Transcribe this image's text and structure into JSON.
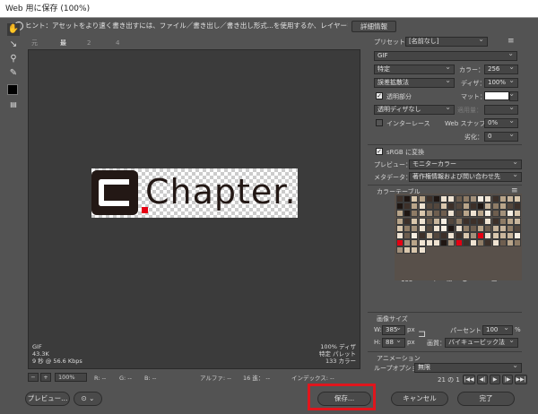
{
  "window": {
    "title": "Web 用に保存 (100%)"
  },
  "hint": {
    "text": "ヒント：アセットをより速く書き出すには、ファイル／書き出し／書き出し形式...を使用するか、レイヤーを右クリックして使用。",
    "detail_button": "詳細情報"
  },
  "tabs": [
    "元画像",
    "最適化",
    "2 アップ",
    "4 アップ"
  ],
  "active_tab": "最適化",
  "preview": {
    "logo_text": "Chapter."
  },
  "canvas_info_left": [
    "GIF",
    "43.3K",
    "9 秒 @ 56.6 Kbps"
  ],
  "canvas_info_right": [
    "100% ディザ",
    "特定 パレット",
    "133 カラー"
  ],
  "statusbar": {
    "zoom": "100%",
    "r": "R: --",
    "g": "G: --",
    "b": "B: --",
    "alpha": "アルファ: --",
    "hex": "16 進： --",
    "index": "インデックス: --"
  },
  "right": {
    "preset_label": "プリセット：",
    "preset_value": "[名前なし]",
    "format": "GIF",
    "palette": "特定",
    "colors_label": "カラー：",
    "colors_value": "256",
    "dither_algo": "誤差拡散法",
    "dither_label": "ディザ：",
    "dither_value": "100%",
    "transparency_label": "透明部分",
    "matte_label": "マット：",
    "transparency_dither": "透明ディザなし",
    "amount_label": "適用量：",
    "interlace_label": "インターレース",
    "web_snap_label": "Web スナップ：",
    "web_snap_value": "0%",
    "lossy_label": "劣化：",
    "lossy_value": "0",
    "srgb_label": "sRGB に変換",
    "preview_label": "プレビュー：",
    "preview_value": "モニターカラー",
    "metadata_label": "メタデータ：",
    "metadata_value": "著作権情報および問い合わせ先",
    "color_table_label": "カラーテーブル",
    "color_count": "133",
    "image_size_label": "画像サイズ",
    "w_label": "W:",
    "w_value": "385",
    "h_label": "H:",
    "h_value": "88",
    "unit": "px",
    "percent_label": "パーセント：",
    "percent_value": "100",
    "percent_unit": "%",
    "quality_label": "画質：",
    "quality_value": "バイキュービック法",
    "animation_label": "アニメーション",
    "loop_label": "ループオプション：",
    "loop_value": "無限",
    "frame_counter": "21 の 1"
  },
  "buttons": {
    "preview": "プレビュー...",
    "save": "保存...",
    "cancel": "キャンセル",
    "done": "完了"
  },
  "colors": {
    "accent_red": "#e0161d",
    "panel": "#535353"
  }
}
